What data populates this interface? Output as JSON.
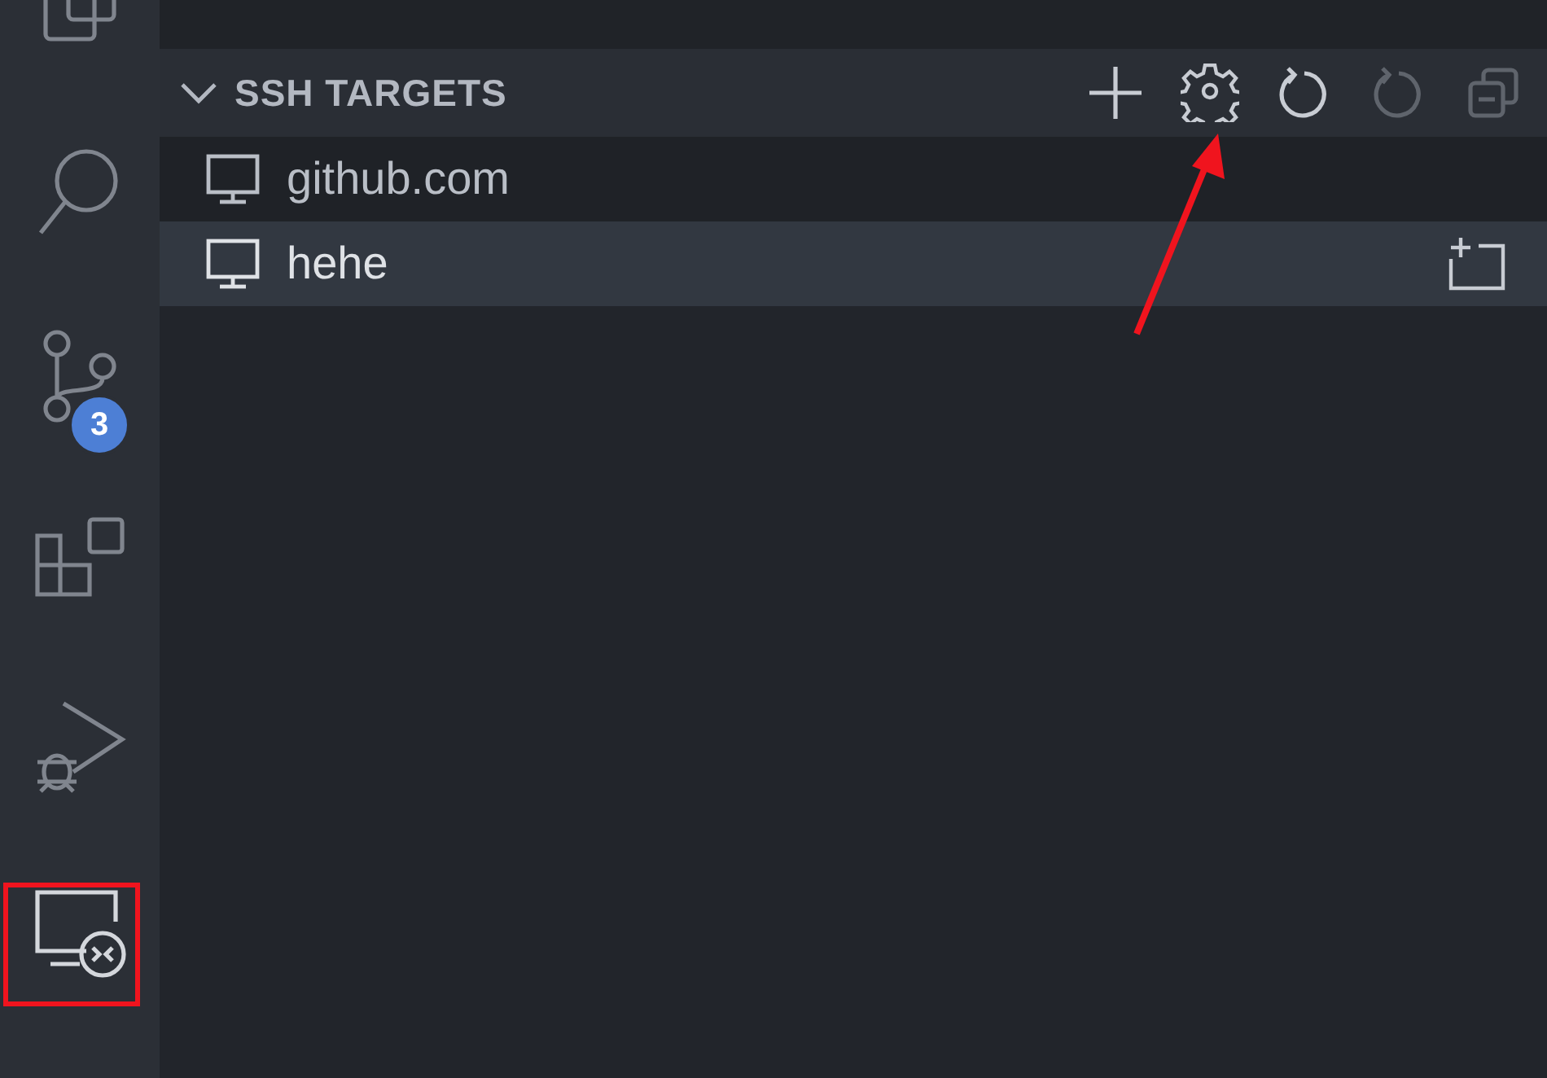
{
  "activity_bar": [
    {
      "kind": "explorer",
      "selected": false
    },
    {
      "kind": "search",
      "selected": false
    },
    {
      "kind": "source-control",
      "selected": false,
      "badge": "3"
    },
    {
      "kind": "extensions",
      "selected": false
    },
    {
      "kind": "run-debug",
      "selected": false
    },
    {
      "kind": "remote",
      "selected": true
    }
  ],
  "section": {
    "title": "SSH TARGETS",
    "expanded": true,
    "actions": [
      {
        "kind": "add",
        "disabled": false
      },
      {
        "kind": "settings",
        "disabled": false
      },
      {
        "kind": "refresh",
        "disabled": false
      },
      {
        "kind": "refresh",
        "disabled": true
      },
      {
        "kind": "collapse",
        "disabled": true
      }
    ],
    "targets": [
      {
        "label": "github.com",
        "selected": false
      },
      {
        "label": "hehe",
        "selected": true
      }
    ]
  }
}
